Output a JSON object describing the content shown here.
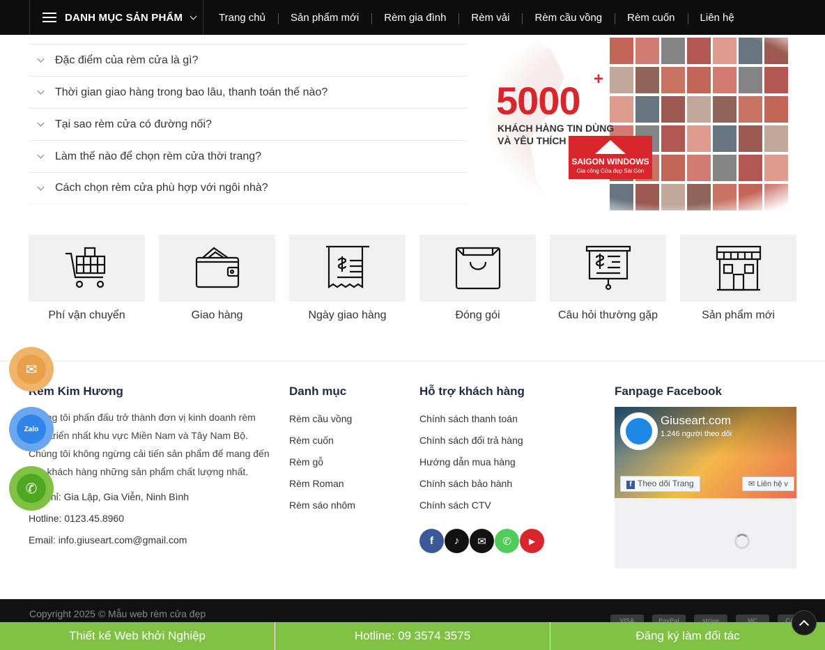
{
  "nav": {
    "category_label": "DANH MỤC SẢN PHẨM",
    "items": [
      "Trang chủ",
      "Sản phẩm mới",
      "Rèm gia đình",
      "Rèm vải",
      "Rèm cầu vồng",
      "Rèm cuốn",
      "Liên hệ"
    ]
  },
  "faq": [
    "Đặc điểm của rèm cửa là gì?",
    "Thời gian giao hàng trong bao lâu, thanh toán thế nào?",
    "Tại sao rèm cửa có đường nối?",
    "Làm thế nào để chọn rèm cửa thời trang?",
    "Cách chọn rèm cửa phù hợp với ngôi nhà?"
  ],
  "banner": {
    "number": "5000",
    "plus": "+",
    "line1": "KHÁCH HÀNG TIN DÙNG",
    "line2": "VÀ YÊU THÍCH",
    "logo_name": "SAIGON WINDOWS",
    "logo_sub": "Gia công Cửa đẹp Sài Gòn"
  },
  "features": [
    {
      "label": "Phí vận chuyển",
      "icon": "shopping-cart-icon"
    },
    {
      "label": "Giao hàng",
      "icon": "wallet-icon"
    },
    {
      "label": "Ngày giao hàng",
      "icon": "receipt-icon"
    },
    {
      "label": "Đóng gói",
      "icon": "shopping-bag-icon"
    },
    {
      "label": "Câu hỏi thường gặp",
      "icon": "presentation-board-icon"
    },
    {
      "label": "Sản phẩm mới",
      "icon": "storefront-icon"
    }
  ],
  "about": {
    "title": "Rèm Kim Hương",
    "text": "Chúng tôi phấn đấu trở thành đơn vị kinh doanh rèm phát triển nhất khu vực Miền Nam và Tây Nam Bộ. Chúng tôi không ngừng cải tiến sản phẩm để mang đến cho khách hàng những sản phẩm chất lượng nhất.",
    "address": "Địa chỉ: Gia Lập, Gia Viễn, Ninh Bình",
    "hotline": "Hotline: 0123.45.8960",
    "email": "Email: info.giuseart.com@gmail.com"
  },
  "categories": {
    "title": "Danh mục",
    "items": [
      "Rèm cầu vồng",
      "Rèm cuốn",
      "Rèm gỗ",
      "Rèm Roman",
      "Rèm sáo nhôm"
    ]
  },
  "support": {
    "title": "Hỗ trợ khách hàng",
    "items": [
      "Chính sách thanh toán",
      "Chính sách đổi trả hàng",
      "Hướng dẫn mua hàng",
      "Chính sách bảo hành",
      "Chính sách CTV"
    ]
  },
  "socials": [
    {
      "icon": "facebook-icon",
      "glyph": "f",
      "color": "#3b5998"
    },
    {
      "icon": "tiktok-icon",
      "glyph": "♪",
      "color": "#111111"
    },
    {
      "icon": "email-icon",
      "glyph": "✉",
      "color": "#111111"
    },
    {
      "icon": "phone-icon",
      "glyph": "✆",
      "color": "#51cb5a"
    },
    {
      "icon": "youtube-icon",
      "glyph": "▶",
      "color": "#d9252c"
    }
  ],
  "fanpage": {
    "title": "Fanpage Facebook",
    "name": "Giuseart.com",
    "followers": "1.246 người theo dõi",
    "follow_label": "Theo dõi Trang",
    "contact_label": "✉ Liên hệ v"
  },
  "floating": [
    {
      "icon": "mail-icon",
      "glyph": "✉",
      "ring": "#f0b36a",
      "fill": "#e8a04a"
    },
    {
      "icon": "zalo-icon",
      "glyph": "Zalo",
      "ring": "#69a8ef",
      "fill": "#2f86e8"
    },
    {
      "icon": "phone-icon",
      "glyph": "✆",
      "ring": "#7fc243",
      "fill": "#4fa821"
    }
  ],
  "footer": {
    "copyright": "Copyright 2025 © Mẫu web rèm cửa đẹp",
    "payments": [
      "VISA",
      "PayPal",
      "stripe",
      "MC",
      "CASH"
    ]
  },
  "cta": [
    "Thiết kế Web khởi Nghiệp",
    "Hotline: 09 3574 3575",
    "Đăng ký làm đối tác"
  ]
}
